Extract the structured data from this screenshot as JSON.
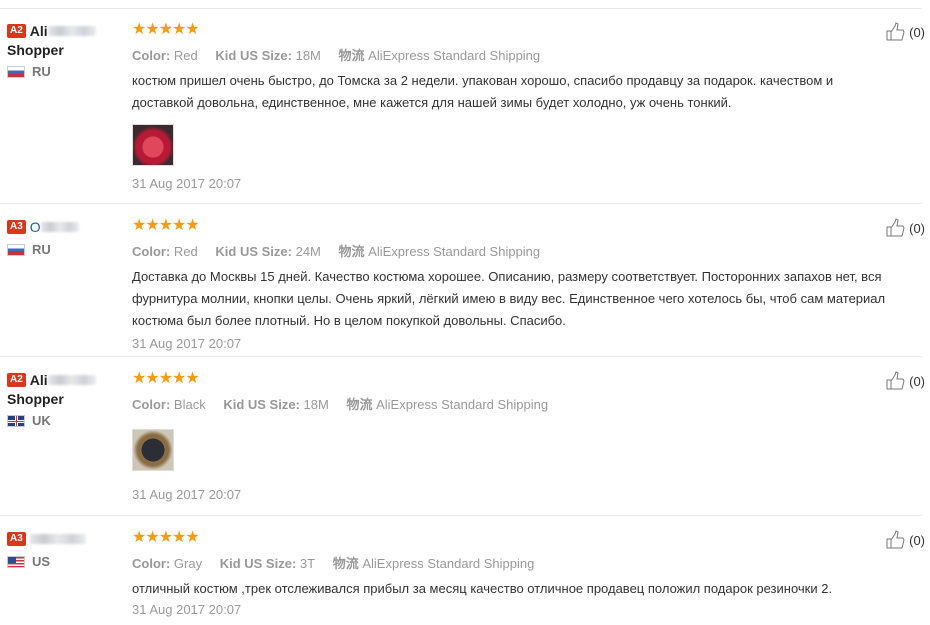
{
  "colors": {
    "stars": "#f39c12",
    "badge": "#d9361e",
    "meta": "#999999"
  },
  "reviews": [
    {
      "badge": "A2",
      "name_prefix": "Ali",
      "name_line2": "Shopper",
      "country": "RU",
      "flag": "ru",
      "stars": "★★★★★",
      "color_label": "Color:",
      "color_value": "Red",
      "size_label": "Kid US Size:",
      "size_value": "18M",
      "ship_label": "物流",
      "ship_value": "AliExpress Standard Shipping",
      "text": "костюм пришел очень быстро, до Томска за 2 недели. упакован хорошо, спасибо продавцу за подарок. качеством и доставкой довольна, единственное, мне кажется для нашей зимы будет холодно, уж очень тонкий.",
      "date": "31 Aug 2017 20:07",
      "helpful": "(0)"
    },
    {
      "badge": "A3",
      "name_prefix": "O",
      "name_line2": "",
      "country": "RU",
      "flag": "ru",
      "stars": "★★★★★",
      "color_label": "Color:",
      "color_value": "Red",
      "size_label": "Kid US Size:",
      "size_value": "24M",
      "ship_label": "物流",
      "ship_value": "AliExpress Standard Shipping",
      "text": "Доставка до Москвы 15 дней. Качество костюма хорошее. Описанию, размеру соответствует. Посторонних запахов нет, вся фурнитура молнии, кнопки целы. Очень яркий, лёгкий имею в виду вес. Единственное чего хотелось бы, чтоб сам материал костюма был более плотный. Но в целом покупкой довольны. Спасибо.",
      "date": "31 Aug 2017 20:07",
      "helpful": "(0)"
    },
    {
      "badge": "A2",
      "name_prefix": "Ali",
      "name_line2": "Shopper",
      "country": "UK",
      "flag": "uk",
      "stars": "★★★★★",
      "color_label": "Color:",
      "color_value": "Black",
      "size_label": "Kid US Size:",
      "size_value": "18M",
      "ship_label": "物流",
      "ship_value": "AliExpress Standard Shipping",
      "text": "",
      "date": "31 Aug 2017 20:07",
      "helpful": "(0)"
    },
    {
      "badge": "A3",
      "name_prefix": "",
      "name_line2": "",
      "country": "US",
      "flag": "us",
      "stars": "★★★★★",
      "color_label": "Color:",
      "color_value": "Gray",
      "size_label": "Kid US Size:",
      "size_value": "3T",
      "ship_label": "物流",
      "ship_value": "AliExpress Standard Shipping",
      "text": "отличный костюм ,трек отслеживался прибыл за месяц качество отличное продавец положил подарок резиночки 2.",
      "date": "31 Aug 2017 20:07",
      "helpful": "(0)"
    }
  ]
}
